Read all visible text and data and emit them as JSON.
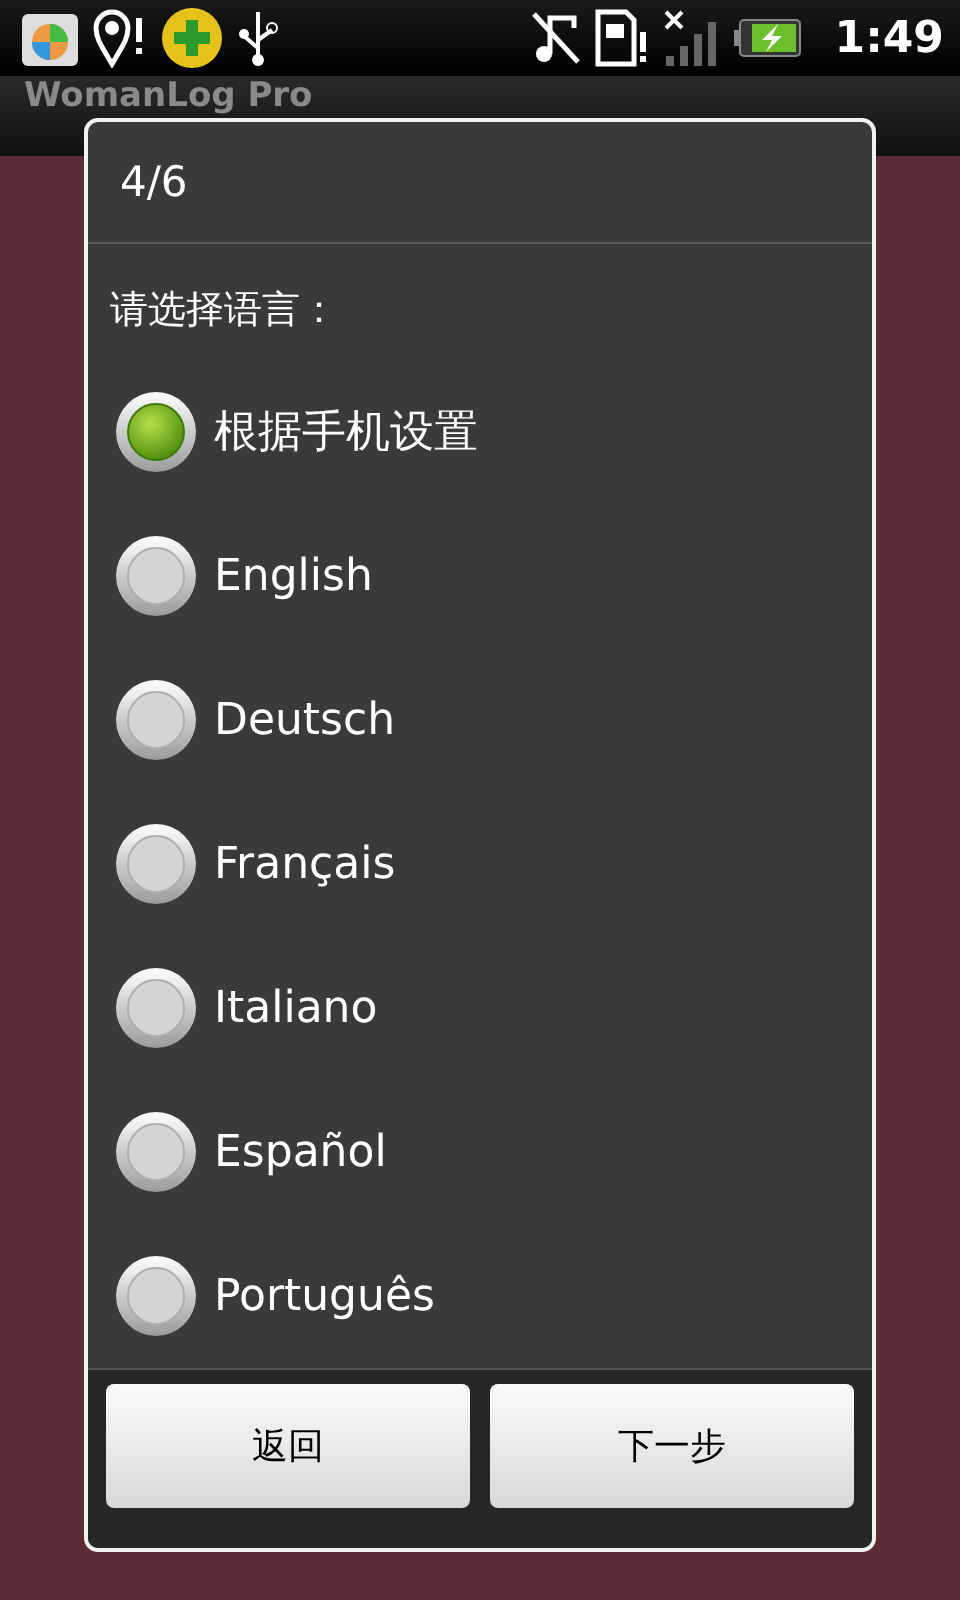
{
  "status_bar": {
    "time": "1:49"
  },
  "app_bar": {
    "title": "WomanLog Pro"
  },
  "dialog": {
    "title": "4/6",
    "prompt": "请选择语言：",
    "options": [
      {
        "label": "根据手机设置",
        "selected": true
      },
      {
        "label": "English",
        "selected": false
      },
      {
        "label": "Deutsch",
        "selected": false
      },
      {
        "label": "Français",
        "selected": false
      },
      {
        "label": "Italiano",
        "selected": false
      },
      {
        "label": "Español",
        "selected": false
      },
      {
        "label": "Português",
        "selected": false
      }
    ],
    "buttons": [
      "返回",
      "下一步"
    ]
  }
}
